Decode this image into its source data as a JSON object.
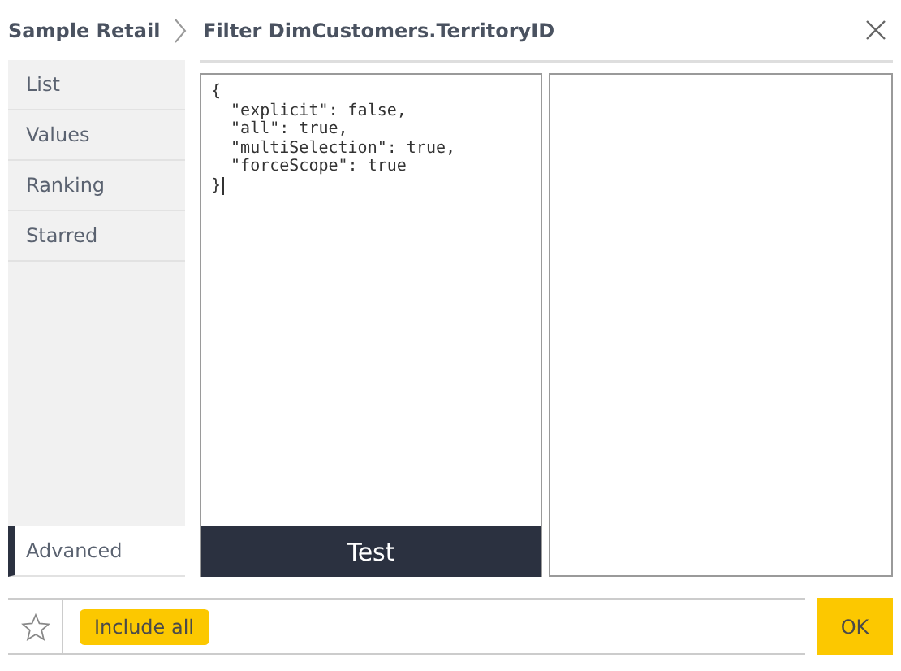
{
  "breadcrumb": {
    "parent": "Sample Retail",
    "title": "Filter DimCustomers.TerritoryID"
  },
  "sidebar": {
    "items": [
      {
        "label": "List",
        "selected": false
      },
      {
        "label": "Values",
        "selected": false
      },
      {
        "label": "Ranking",
        "selected": false
      },
      {
        "label": "Starred",
        "selected": false
      }
    ],
    "bottom_items": [
      {
        "label": "Advanced",
        "selected": true
      }
    ]
  },
  "editor": {
    "code_lines": [
      "{",
      "  \"explicit\": false,",
      "  \"all\": true,",
      "  \"multiSelection\": true,",
      "  \"forceScope\": true",
      "}"
    ],
    "test_button": "Test"
  },
  "footer": {
    "starred": false,
    "chips": [
      "Include all"
    ],
    "ok_button": "OK"
  }
}
